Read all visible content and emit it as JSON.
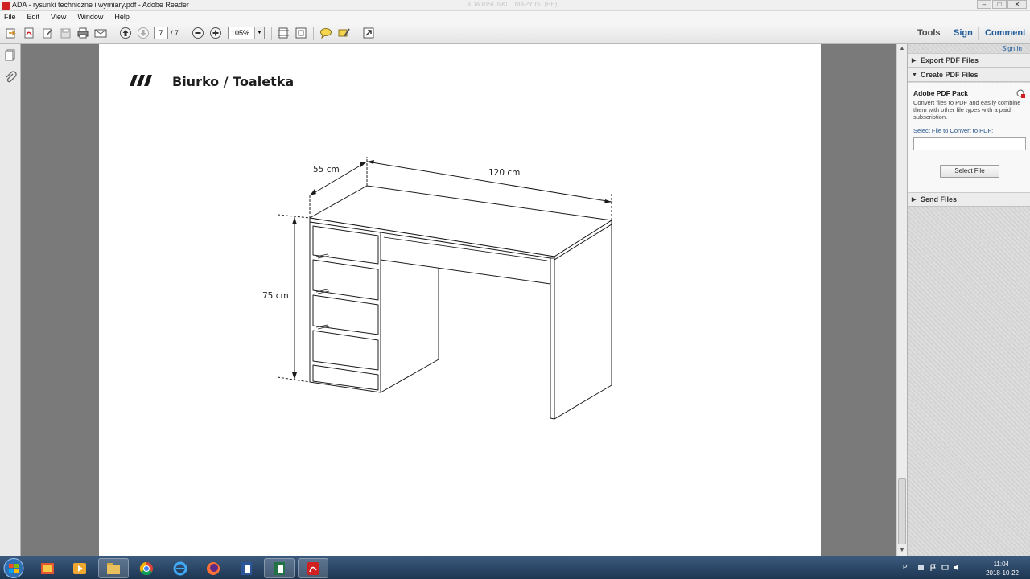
{
  "window": {
    "title": "ADA - rysunki techniczne i wymiary.pdf - Adobe Reader",
    "ghost_title": "ADA RISUNKI... MAPY IS. (EE)",
    "controls": {
      "minimize": "–",
      "maximize": "□",
      "close": "✕"
    }
  },
  "menu": {
    "items": [
      "File",
      "Edit",
      "View",
      "Window",
      "Help"
    ]
  },
  "toolbar": {
    "page_current": "7",
    "page_total": "/ 7",
    "zoom": "105%",
    "zoom_dropdown": "▼",
    "tools_label": "Tools",
    "sign_label": "Sign",
    "comment_label": "Comment"
  },
  "document": {
    "heading": "Biurko / Toaletka",
    "dim_depth": "55 cm",
    "dim_width": "120 cm",
    "dim_height": "75 cm"
  },
  "right_pane": {
    "sign_in": "Sign In",
    "export_label": "Export PDF Files",
    "create_label": "Create PDF Files",
    "pack_title": "Adobe PDF Pack",
    "pack_desc": "Convert files to PDF and easily combine them with other file types with a paid subscription.",
    "select_label": "Select File to Convert to PDF:",
    "select_button": "Select File",
    "send_label": "Send Files",
    "tri_collapsed": "▶",
    "tri_expanded": "▼"
  },
  "scrollbar": {
    "up": "▲",
    "down": "▼"
  },
  "taskbar": {
    "lang": "PL",
    "time": "11:04",
    "date": "2018-10-22"
  },
  "colors": {
    "accent_blue": "#1f5b9b",
    "taskbar": "#2a4566",
    "adobe_red": "#d21f1f"
  }
}
